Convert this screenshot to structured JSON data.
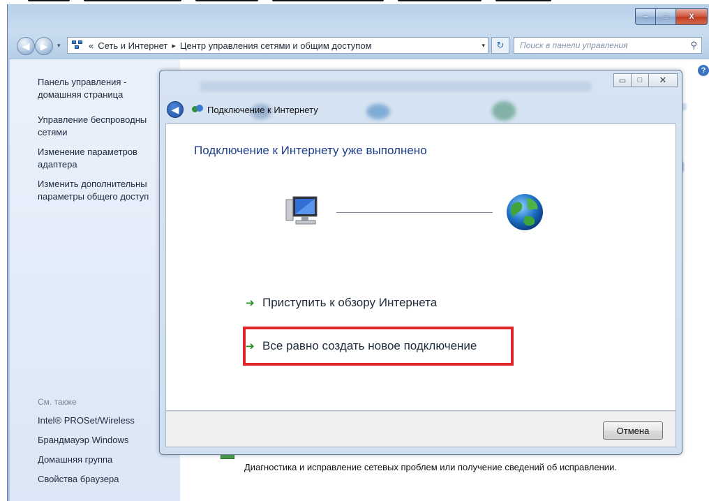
{
  "window": {
    "minimize_glyph": "–",
    "maximize_glyph": "□",
    "close_glyph": "X"
  },
  "address_bar": {
    "chevron": "«",
    "crumb1": "Сеть и Интернет",
    "separator": "▸",
    "crumb2": "Центр управления сетями и общим доступом",
    "dropdown": "▾",
    "refresh": "↻"
  },
  "search": {
    "placeholder": "Поиск в панели управления",
    "icon": "search-icon"
  },
  "sidebar": {
    "items": [
      {
        "label_line1": "Панель управления -",
        "label_line2": "домашняя страница"
      },
      {
        "label_line1": "Управление беспроводны",
        "label_line2": "сетями"
      },
      {
        "label_line1": "Изменение параметров",
        "label_line2": "адаптера"
      },
      {
        "label_line1": "Изменить дополнительны",
        "label_line2": "параметры общего доступ"
      }
    ],
    "see_also": "См. также",
    "links": [
      "Intel® PROSet/Wireless",
      "Брандмауэр Windows",
      "Домашняя группа",
      "Свойства браузера"
    ]
  },
  "background": {
    "bottom_text": "Диагностика и исправление сетевых проблем или получение сведений об исправлении."
  },
  "dialog": {
    "title": "Подключение к Интернету",
    "heading": "Подключение к Интернету уже выполнено",
    "options": [
      {
        "label": "Приступить к обзору Интернета"
      },
      {
        "label": "Все равно создать новое подключение"
      }
    ],
    "arrow": "➔",
    "cancel_label": "Отмена"
  },
  "colors": {
    "highlight_box": "#e0262b",
    "heading_blue": "#1e3f8c",
    "arrow_green": "#1f8f1f"
  }
}
